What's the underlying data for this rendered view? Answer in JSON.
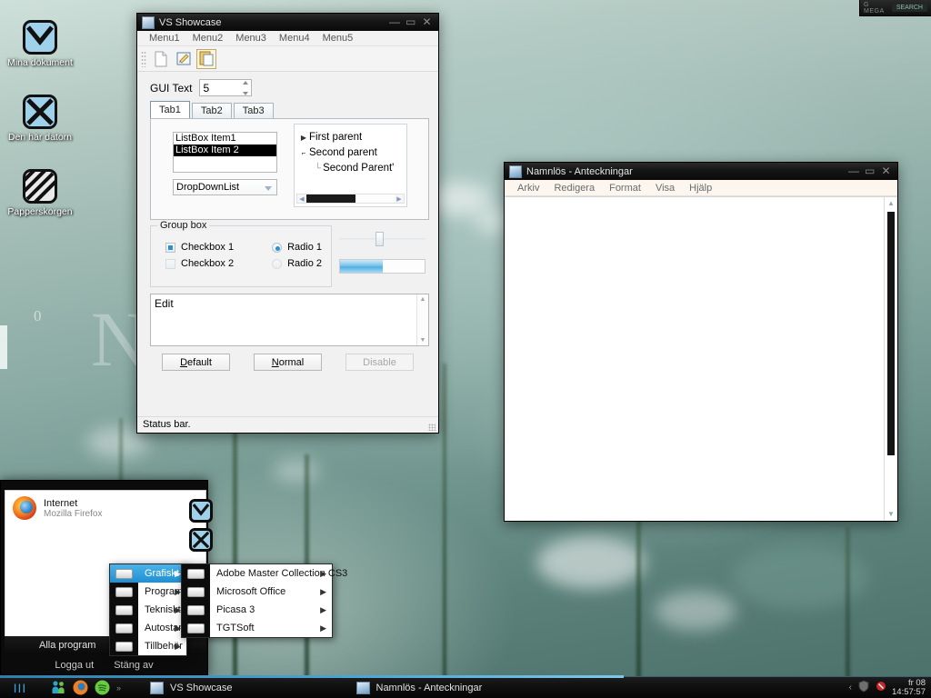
{
  "desktop": {
    "icons": [
      {
        "label": "Mina dokument",
        "icon": "envelope-icon"
      },
      {
        "label": "Den här datorn",
        "icon": "computer-x-icon"
      },
      {
        "label": "Papperskorgen",
        "icon": "recycle-bin-icon"
      }
    ],
    "watermark_letter": "N",
    "watermark_zero": "0"
  },
  "top_widget": {
    "left_label": "G MEGA",
    "right_label": "SEARCH"
  },
  "vs_showcase": {
    "title": "VS Showcase",
    "window_buttons": {
      "minimize": "—",
      "maximize": "▭",
      "close": "✕"
    },
    "menus": [
      "Menu1",
      "Menu2",
      "Menu3",
      "Menu4",
      "Menu5"
    ],
    "toolbar_icons": [
      "new-document-icon",
      "edit-document-icon",
      "copy-paste-icon"
    ],
    "gui_text": {
      "label": "GUI Text",
      "value": "5"
    },
    "tabs": [
      {
        "label": "Tab1",
        "active": true
      },
      {
        "label": "Tab2",
        "active": false
      },
      {
        "label": "Tab3",
        "active": false
      }
    ],
    "listbox": {
      "items": [
        {
          "text": "ListBox Item1",
          "selected": false
        },
        {
          "text": "ListBox Item 2",
          "selected": true
        }
      ]
    },
    "dropdown": {
      "value": "DropDownList"
    },
    "tree": {
      "nodes": [
        {
          "text": "First parent",
          "expanded": false,
          "child": false
        },
        {
          "text": "Second parent",
          "expanded": true,
          "child": false
        },
        {
          "text": "Second Parent'",
          "expanded": false,
          "child": true
        }
      ],
      "hscroll_thumb_percent": 56
    },
    "groupbox": {
      "title": "Group box",
      "checkboxes": [
        {
          "label": "Checkbox 1",
          "checked": true
        },
        {
          "label": "Checkbox 2",
          "checked": false
        }
      ],
      "radios": [
        {
          "label": "Radio 1",
          "checked": true
        },
        {
          "label": "Radio 2",
          "checked": false
        }
      ]
    },
    "slider": {
      "value_percent": 45
    },
    "progress": {
      "value_percent": 50
    },
    "edit": {
      "text": "Edit"
    },
    "buttons": [
      {
        "label": "Default",
        "mnemonic": "D",
        "disabled": false
      },
      {
        "label": "Normal",
        "mnemonic": "N",
        "disabled": false
      },
      {
        "label": "Disable",
        "mnemonic": "",
        "disabled": true
      }
    ],
    "statusbar": {
      "text": "Status bar."
    }
  },
  "notepad": {
    "title": "Namnlös - Anteckningar",
    "window_buttons": {
      "minimize": "—",
      "maximize": "▭",
      "close": "✕"
    },
    "menus": [
      "Arkiv",
      "Redigera",
      "Format",
      "Visa",
      "Hjälp"
    ],
    "content": ""
  },
  "start_menu": {
    "internet": {
      "title": "Internet",
      "subtitle": "Mozilla Firefox",
      "icon": "firefox-icon"
    },
    "all_programs": {
      "label": "Alla program",
      "arrow": "▶"
    },
    "footer": {
      "logout": "Logga ut",
      "shutdown": "Stäng av"
    },
    "submenu_1": [
      {
        "label": "Grafiskt",
        "highlighted": true,
        "arrow": "▶"
      },
      {
        "label": "Program",
        "highlighted": false,
        "arrow": "▶"
      },
      {
        "label": "Tekniskt",
        "highlighted": false,
        "arrow": "▶"
      },
      {
        "label": "Autostart",
        "highlighted": false,
        "arrow": "▶"
      },
      {
        "label": "Tillbehör",
        "highlighted": false,
        "arrow": "▶"
      }
    ],
    "submenu_2": [
      {
        "label": "Adobe Master Collection CS3",
        "arrow": "▶"
      },
      {
        "label": "Microsoft Office",
        "arrow": "▶"
      },
      {
        "label": "Picasa 3",
        "arrow": "▶"
      },
      {
        "label": "TGTSoft",
        "arrow": "▶"
      }
    ]
  },
  "taskbar": {
    "start_label": "III",
    "quick_launch": [
      "users-icon",
      "firefox-icon",
      "spotify-icon"
    ],
    "quick_overflow": "»",
    "tasks": [
      {
        "label": "VS Showcase",
        "icon": "vs-showcase-icon"
      },
      {
        "label": "Namnlös - Anteckningar",
        "icon": "notepad-icon"
      }
    ],
    "tray": {
      "chevron": "‹",
      "icons": [
        "shield-icon",
        "network-icon"
      ]
    },
    "clock": {
      "date": "fr 08",
      "time": "14:57:57"
    }
  },
  "colors": {
    "accent": "#4ea7d6",
    "selection": "#1f8fd4",
    "progress": "#4fb0e4",
    "taskbar": "#0a0a0a"
  }
}
